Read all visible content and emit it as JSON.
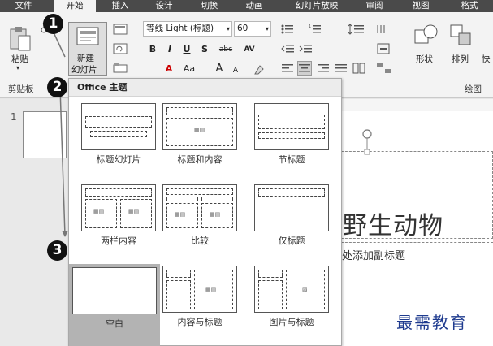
{
  "tabs": [
    {
      "label": "文件",
      "active": false
    },
    {
      "label": "开始",
      "active": true
    },
    {
      "label": "插入",
      "active": false
    },
    {
      "label": "设计",
      "active": false
    },
    {
      "label": "切换",
      "active": false
    },
    {
      "label": "动画",
      "active": false
    },
    {
      "label": "幻灯片放映",
      "active": false
    },
    {
      "label": "审阅",
      "active": false
    },
    {
      "label": "视图",
      "active": false
    },
    {
      "label": "格式",
      "active": false
    }
  ],
  "ribbon": {
    "paste_label": "粘贴",
    "clipboard_group": "剪贴板",
    "new_slide_line1": "新建",
    "new_slide_line2": "幻灯片",
    "font_name": "等线 Light (标题)",
    "font_size": "60",
    "bold": "B",
    "italic": "I",
    "underline": "U",
    "shadow": "S",
    "strike": "abc",
    "spacing": "AV",
    "font_color": "A",
    "case": "Aa",
    "grow": "A",
    "shrink": "A",
    "shape_label": "形状",
    "arrange_label": "排列",
    "quick_label": "快",
    "drawing_group": "绘图"
  },
  "thumbnails": {
    "slide_number": "1"
  },
  "slide": {
    "title": "野生动物",
    "subtitle": "此处添加副标题"
  },
  "gallery": {
    "header": "Office 主题",
    "layouts": [
      {
        "label": "标题幻灯片"
      },
      {
        "label": "标题和内容"
      },
      {
        "label": "节标题"
      },
      {
        "label": "两栏内容"
      },
      {
        "label": "比较"
      },
      {
        "label": "仅标题"
      },
      {
        "label": "空白",
        "selected": true
      },
      {
        "label": "内容与标题"
      },
      {
        "label": "图片与标题"
      }
    ]
  },
  "steps": [
    "1",
    "2",
    "3"
  ],
  "watermark": "最需教育",
  "colors": {
    "tabbar": "#4a4a4a",
    "ribbon": "#f3f3f3",
    "selected_layout": "#b3b3b3",
    "watermark": "#1f3b8f"
  }
}
